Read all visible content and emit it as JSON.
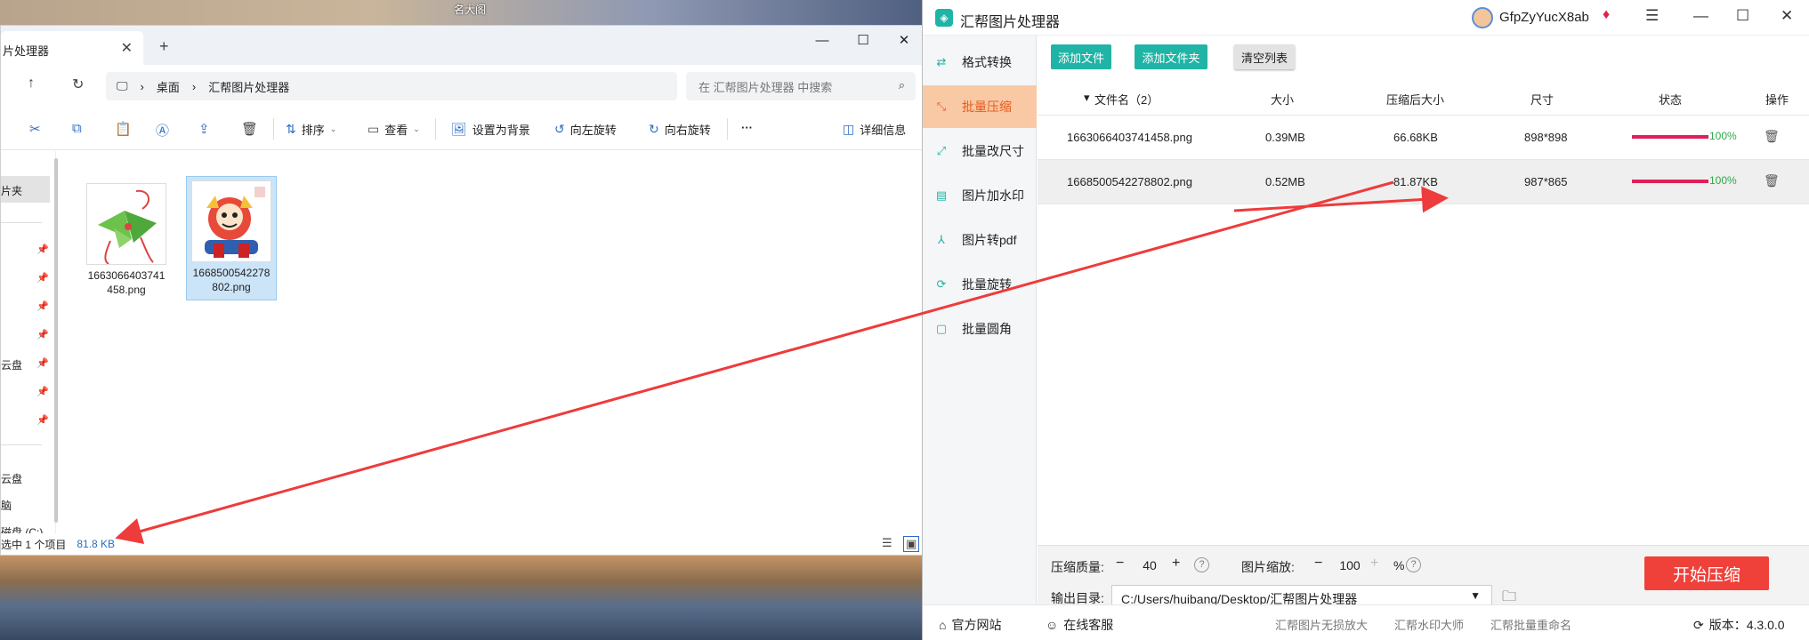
{
  "desktop": {
    "caption": "名大阁"
  },
  "explorer": {
    "tab_title": "片处理器",
    "breadcrumb": [
      "桌面",
      "汇帮图片处理器"
    ],
    "search_placeholder": "在 汇帮图片处理器 中搜索",
    "toolbar": {
      "sort": "排序",
      "view": "查看",
      "set_background": "设置为背景",
      "rotate_left": "向左旋转",
      "rotate_right": "向右旋转",
      "more": "···",
      "details": "详细信息"
    },
    "nav": {
      "quick_access": "片夹",
      "cloud1": "云盘",
      "cloud2": "云盘",
      "item3": "脑",
      "item4": "磁盘 (C:)"
    },
    "files": [
      {
        "name": "1663066403741458.png",
        "selected": false
      },
      {
        "name": "1668500542278802.png",
        "selected": true
      }
    ],
    "status": {
      "selection": "选中 1 个项目",
      "size": "81.8 KB"
    }
  },
  "app": {
    "title": "汇帮图片处理器",
    "user": "GfpZyYucX8ab",
    "sidebar": [
      {
        "label": "格式转换",
        "icon": "convert-icon",
        "active": false
      },
      {
        "label": "批量压缩",
        "icon": "compress-icon",
        "active": true
      },
      {
        "label": "批量改尺寸",
        "icon": "resize-icon",
        "active": false
      },
      {
        "label": "图片加水印",
        "icon": "watermark-icon",
        "active": false
      },
      {
        "label": "图片转pdf",
        "icon": "pdf-icon",
        "active": false
      },
      {
        "label": "批量旋转",
        "icon": "rotate-icon",
        "active": false
      },
      {
        "label": "批量圆角",
        "icon": "round-corner-icon",
        "active": false
      }
    ],
    "actions": {
      "add_file": "添加文件",
      "add_folder": "添加文件夹",
      "clear_list": "清空列表"
    },
    "table": {
      "headers": {
        "name": "文件名（2）",
        "size": "大小",
        "compressed": "压缩后大小",
        "dims": "尺寸",
        "status": "状态",
        "ops": "操作"
      },
      "rows": [
        {
          "name": "1663066403741458.png",
          "size": "0.39MB",
          "compressed": "66.68KB",
          "dims": "898*898",
          "progress": 1.0,
          "pct": "100%"
        },
        {
          "name": "1668500542278802.png",
          "size": "0.52MB",
          "compressed": "81.87KB",
          "dims": "987*865",
          "progress": 1.0,
          "pct": "100%"
        }
      ]
    },
    "settings": {
      "quality_label": "压缩质量:",
      "quality_value": "40",
      "scale_label": "图片缩放:",
      "scale_value": "100",
      "scale_unit": "%",
      "output_label": "输出目录:",
      "output_path": "C:/Users/huibang/Desktop/汇帮图片处理器",
      "start_button": "开始压缩"
    },
    "footer": {
      "website": "官方网站",
      "support": "在线客服",
      "links": [
        "汇帮图片无损放大",
        "汇帮水印大师",
        "汇帮批量重命名"
      ],
      "version": "版本：4.3.0.0"
    }
  },
  "colors": {
    "accent_green": "#1fb4a6",
    "active_orange": "#e55a1c",
    "start_red": "#f0403a",
    "arrow_red": "#ee3b3b"
  }
}
